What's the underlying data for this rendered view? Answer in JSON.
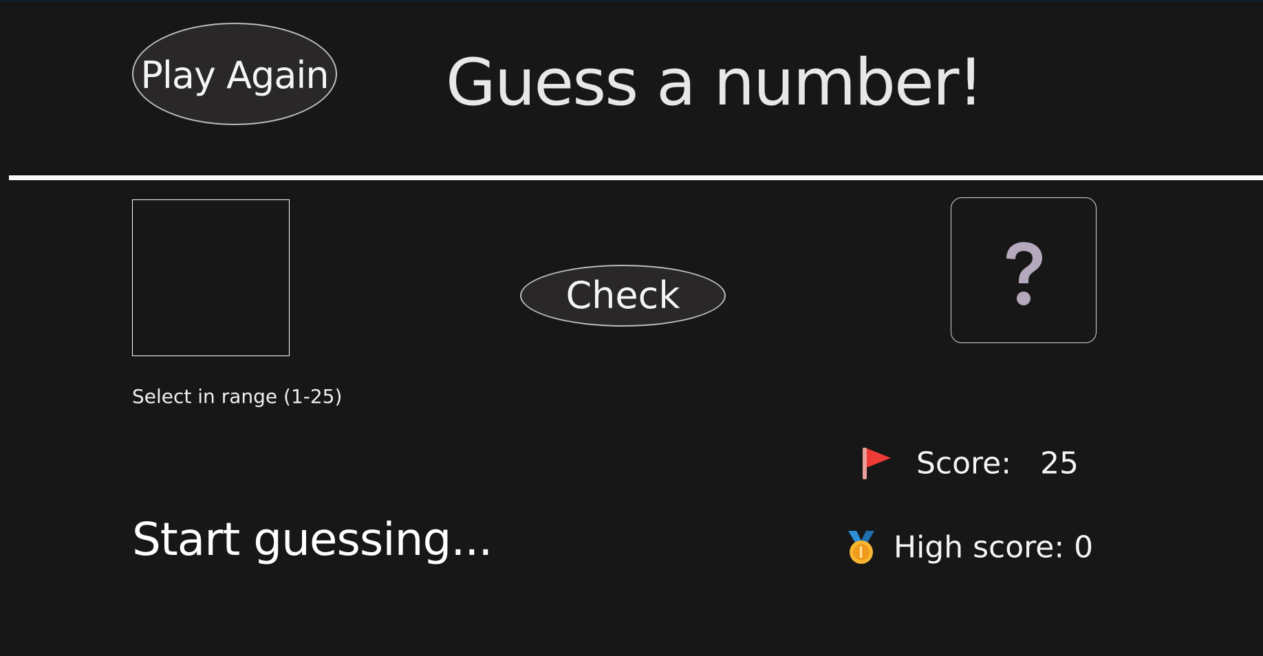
{
  "header": {
    "play_again_label": "Play Again",
    "title": "Guess a number!"
  },
  "game": {
    "input_value": "",
    "range_hint": "Select in range (1-25)",
    "check_label": "Check",
    "secret_display": "?",
    "message": "Start guessing...",
    "score_label": "Score:",
    "score_value": "25",
    "highscore_label": "High score:",
    "highscore_value": "0"
  },
  "icons": {
    "flag": "red-flag-icon",
    "medal": "gold-medal-icon"
  },
  "colors": {
    "background": "#171717",
    "button_fill": "#292727",
    "button_border": "#bdbdbd",
    "question_mark": "#b5a9bd",
    "flag": "#ef3b36",
    "medal_gold": "#f7b733",
    "medal_ribbon": "#2d8fd5"
  }
}
